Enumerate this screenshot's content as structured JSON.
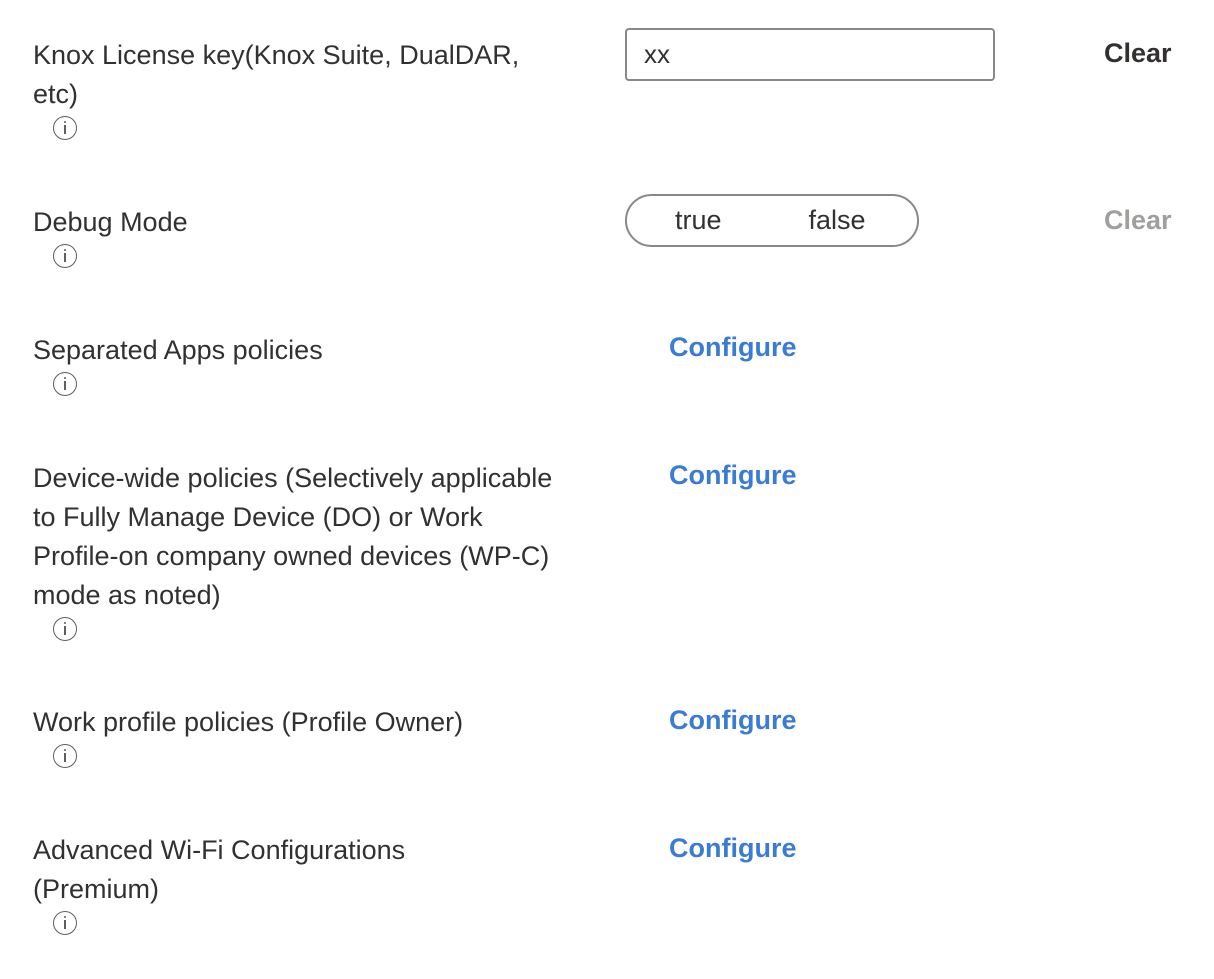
{
  "settings": {
    "knox_license": {
      "label": "Knox License key(Knox Suite, DualDAR, etc)",
      "input_value": "xx",
      "clear_label": "Clear"
    },
    "debug_mode": {
      "label": "Debug Mode",
      "options": [
        "true",
        "false"
      ],
      "selected": null,
      "clear_label": "Clear"
    },
    "separated_apps": {
      "label": "Separated Apps policies",
      "action_label": "Configure"
    },
    "device_wide": {
      "label": "Device-wide policies (Selectively applicable to Fully Manage Device (DO) or Work Profile-on company owned devices (WP-C) mode as noted)",
      "action_label": "Configure"
    },
    "work_profile": {
      "label": "Work profile policies (Profile Owner)",
      "action_label": "Configure"
    },
    "advanced_wifi": {
      "label": "Advanced Wi-Fi Configurations (Premium)",
      "action_label": "Configure"
    }
  },
  "colors": {
    "link": "#3a7bd5",
    "text": "#323130",
    "disabled": "#a19f9d",
    "border": "#8a8886"
  }
}
